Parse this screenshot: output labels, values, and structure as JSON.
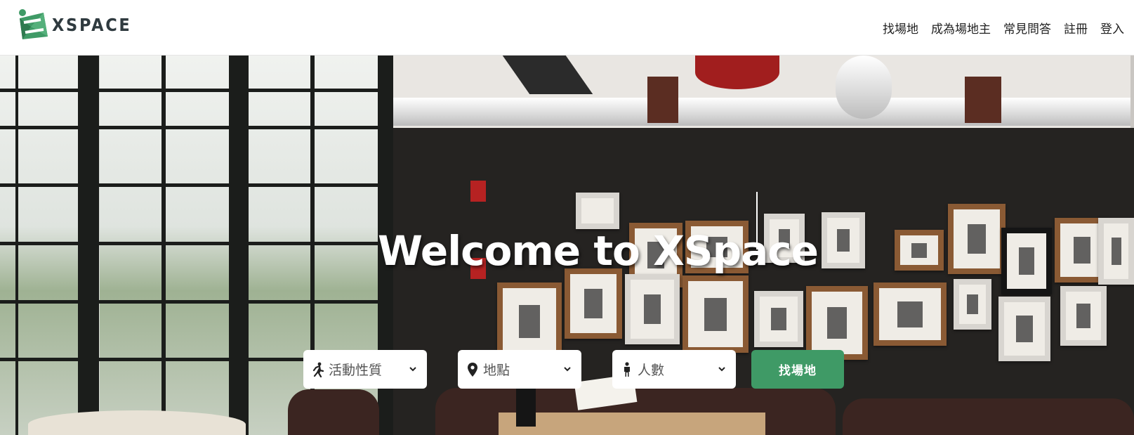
{
  "brand": {
    "name": "XSPACE"
  },
  "nav": {
    "links": [
      {
        "label": "找場地"
      },
      {
        "label": "成為場地主"
      },
      {
        "label": "常見問答"
      },
      {
        "label": "註冊"
      },
      {
        "label": "登入"
      }
    ]
  },
  "hero": {
    "title": "Welcome to XSpace"
  },
  "search": {
    "activity": {
      "label": "活動性質",
      "icon": "running-icon"
    },
    "location": {
      "label": "地點",
      "icon": "map-pin-icon"
    },
    "people": {
      "label": "人數",
      "icon": "person-icon"
    },
    "submit_label": "找場地"
  },
  "colors": {
    "accent": "#3f9a66",
    "brand_green": "#3f9a66",
    "brand_text": "#2f3a3f"
  }
}
